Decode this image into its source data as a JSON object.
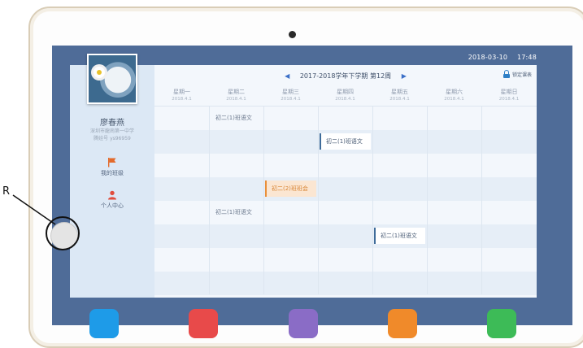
{
  "status_bar": {
    "date": "2018-03-10",
    "time": "17:48"
  },
  "profile": {
    "name": "廖春燕",
    "school": "深圳市龍崗第一中学",
    "id": "腾娃号 ys96959"
  },
  "nav": [
    {
      "label": "我的班级",
      "icon": "flag-icon"
    },
    {
      "label": "个人中心",
      "icon": "person-icon"
    }
  ],
  "schedule": {
    "title": "2017-2018学年下学期 第12周",
    "prev": "◀",
    "next": "▶",
    "lock_label": "锁定课表",
    "days": [
      {
        "name": "星期一",
        "date": "2018.4.1"
      },
      {
        "name": "星期二",
        "date": "2018.4.1"
      },
      {
        "name": "星期三",
        "date": "2018.4.1"
      },
      {
        "name": "星期四",
        "date": "2018.4.1"
      },
      {
        "name": "星期五",
        "date": "2018.4.1"
      },
      {
        "name": "星期六",
        "date": "2018.4.1"
      },
      {
        "name": "星期日",
        "date": "2018.4.1"
      }
    ],
    "classes": [
      {
        "label": "初二(1)班语文",
        "day": "星期二",
        "period": 1,
        "style": "plain"
      },
      {
        "label": "初二(1)班语文",
        "day": "星期四",
        "period": 2,
        "style": "highlight-blue"
      },
      {
        "label": "初二(2)班班会",
        "day": "星期三",
        "period": 4,
        "style": "highlight-orange"
      },
      {
        "label": "初二(1)班语文",
        "day": "星期二",
        "period": 5,
        "style": "plain"
      },
      {
        "label": "初二(1)班语文",
        "day": "星期五",
        "period": 6,
        "style": "highlight-blue"
      }
    ]
  },
  "annotation": {
    "label": "R"
  },
  "colors": {
    "frame_bg": "#4f6c98",
    "accent_blue": "#3b6fc7",
    "accent_orange": "#e88f3a",
    "sidebar_bg": "#dce8f5"
  }
}
